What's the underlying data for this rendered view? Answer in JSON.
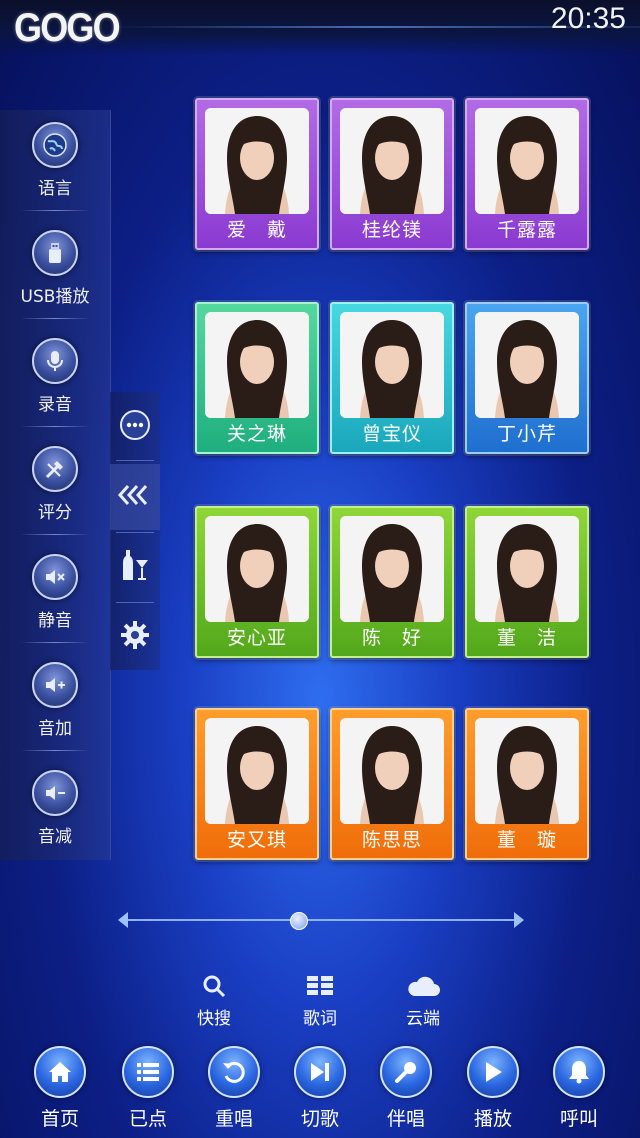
{
  "status_bar": {
    "logo": "GOGO",
    "time": "20:35"
  },
  "sidebar": {
    "items": [
      {
        "label": "语言",
        "icon": "globe-icon"
      },
      {
        "label": "USB播放",
        "icon": "usb-icon"
      },
      {
        "label": "录音",
        "icon": "microphone-icon"
      },
      {
        "label": "评分",
        "icon": "score-icon"
      },
      {
        "label": "静音",
        "icon": "mute-icon"
      },
      {
        "label": "音加",
        "icon": "volume-up-icon"
      },
      {
        "label": "音减",
        "icon": "volume-down-icon"
      }
    ]
  },
  "mid_strip": {
    "icons": [
      "more-icon",
      "collapse-arrows-icon",
      "drinks-icon",
      "settings-gear-icon"
    ]
  },
  "singers": [
    {
      "name": "爱　戴",
      "color": "purple"
    },
    {
      "name": "桂纶镁",
      "color": "purple"
    },
    {
      "name": "千露露",
      "color": "purple"
    },
    {
      "name": "关之琳",
      "color": "tealg"
    },
    {
      "name": "曾宝仪",
      "color": "teal"
    },
    {
      "name": "丁小芹",
      "color": "blue"
    },
    {
      "name": "安心亚",
      "color": "green"
    },
    {
      "name": "陈　好",
      "color": "green"
    },
    {
      "name": "董　洁",
      "color": "green"
    },
    {
      "name": "安又琪",
      "color": "orange"
    },
    {
      "name": "陈思思",
      "color": "orange"
    },
    {
      "name": "董　璇",
      "color": "orange"
    }
  ],
  "slider": {
    "position": 0.44
  },
  "functions": [
    {
      "label": "快搜",
      "icon": "search-icon"
    },
    {
      "label": "歌词",
      "icon": "lyrics-icon"
    },
    {
      "label": "云端",
      "icon": "cloud-icon"
    }
  ],
  "nav": [
    {
      "label": "首页",
      "icon": "home-icon"
    },
    {
      "label": "已点",
      "icon": "list-icon"
    },
    {
      "label": "重唱",
      "icon": "replay-icon"
    },
    {
      "label": "切歌",
      "icon": "skip-icon"
    },
    {
      "label": "伴唱",
      "icon": "mic-icon"
    },
    {
      "label": "播放",
      "icon": "play-icon"
    },
    {
      "label": "呼叫",
      "icon": "bell-icon"
    }
  ]
}
